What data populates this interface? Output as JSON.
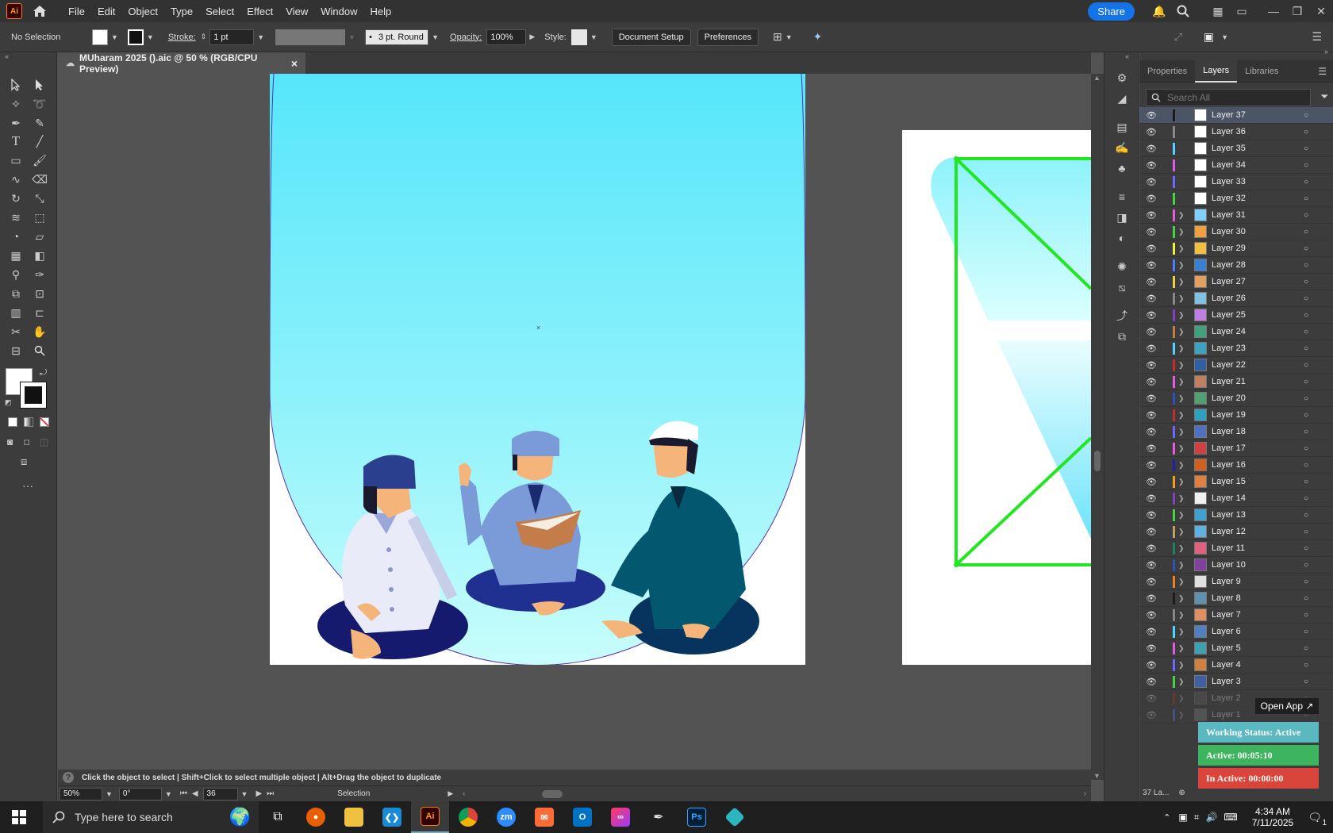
{
  "menubar": {
    "app_icon": "Ai",
    "items": [
      "File",
      "Edit",
      "Object",
      "Type",
      "Select",
      "Effect",
      "View",
      "Window",
      "Help"
    ],
    "share_label": "Share"
  },
  "control_bar": {
    "selection": "No Selection",
    "stroke_label": "Stroke:",
    "stroke_value": "1 pt",
    "brush": "3 pt. Round",
    "opacity_label": "Opacity:",
    "opacity_value": "100%",
    "style_label": "Style:",
    "document_setup": "Document Setup",
    "preferences": "Preferences"
  },
  "document_tab": {
    "title": "MUharam 2025 ().aic @ 50 % (RGB/CPU Preview)",
    "close": "×"
  },
  "status": {
    "hint": "Click the object to select  |  Shift+Click to select multiple object  |  Alt+Drag the object to duplicate",
    "zoom": "50%",
    "rotation": "0°",
    "artboard": "36",
    "tool": "Selection"
  },
  "panel": {
    "tabs": [
      "Properties",
      "Layers",
      "Libraries"
    ],
    "active_tab": "Layers",
    "search_placeholder": "Search All",
    "footer_count": "37 La...",
    "layers": [
      {
        "name": "Layer 37",
        "color": "#1a1a1a",
        "thumb": "#ffffff",
        "expand": false
      },
      {
        "name": "Layer 36",
        "color": "#888888",
        "thumb": "#ffffff",
        "expand": false
      },
      {
        "name": "Layer 35",
        "color": "#4fd6ff",
        "thumb": "#ffffff",
        "expand": false
      },
      {
        "name": "Layer 34",
        "color": "#e05ce0",
        "thumb": "#ffffff",
        "expand": false
      },
      {
        "name": "Layer 33",
        "color": "#6a6aff",
        "thumb": "#ffffff",
        "expand": false
      },
      {
        "name": "Layer 32",
        "color": "#46d446",
        "thumb": "#ffffff",
        "expand": false
      },
      {
        "name": "Layer 31",
        "color": "#e05ce0",
        "thumb": "#7fd0ff",
        "expand": true
      },
      {
        "name": "Layer 30",
        "color": "#46d446",
        "thumb": "#f0a040",
        "expand": true
      },
      {
        "name": "Layer 29",
        "color": "#f0f040",
        "thumb": "#f0c040",
        "expand": true
      },
      {
        "name": "Layer 28",
        "color": "#4f7fff",
        "thumb": "#3a80d0",
        "expand": true
      },
      {
        "name": "Layer 27",
        "color": "#f0d040",
        "thumb": "#e0a060",
        "expand": true
      },
      {
        "name": "Layer 26",
        "color": "#888888",
        "thumb": "#80c0e0",
        "expand": true
      },
      {
        "name": "Layer 25",
        "color": "#8040c0",
        "thumb": "#c080e0",
        "expand": true
      },
      {
        "name": "Layer 24",
        "color": "#c08040",
        "thumb": "#40a080",
        "expand": true
      },
      {
        "name": "Layer 23",
        "color": "#4fd6ff",
        "thumb": "#40a0c0",
        "expand": true
      },
      {
        "name": "Layer 22",
        "color": "#c03030",
        "thumb": "#3060a0",
        "expand": true
      },
      {
        "name": "Layer 21",
        "color": "#e05ce0",
        "thumb": "#c08060",
        "expand": true
      },
      {
        "name": "Layer 20",
        "color": "#3050c0",
        "thumb": "#50a070",
        "expand": true
      },
      {
        "name": "Layer 19",
        "color": "#c03030",
        "thumb": "#30a0c0",
        "expand": true
      },
      {
        "name": "Layer 18",
        "color": "#6a6aff",
        "thumb": "#5070c0",
        "expand": true
      },
      {
        "name": "Layer 17",
        "color": "#e05ce0",
        "thumb": "#d04040",
        "expand": true
      },
      {
        "name": "Layer 16",
        "color": "#2020a0",
        "thumb": "#d06020",
        "expand": true
      },
      {
        "name": "Layer 15",
        "color": "#f0a020",
        "thumb": "#e08040",
        "expand": true
      },
      {
        "name": "Layer 14",
        "color": "#8040c0",
        "thumb": "#f0f0f0",
        "expand": true
      },
      {
        "name": "Layer 13",
        "color": "#46d446",
        "thumb": "#40a0d0",
        "expand": true
      },
      {
        "name": "Layer 12",
        "color": "#c0a060",
        "thumb": "#60b0e0",
        "expand": true
      },
      {
        "name": "Layer 11",
        "color": "#208060",
        "thumb": "#e06080",
        "expand": true
      },
      {
        "name": "Layer 10",
        "color": "#3050c0",
        "thumb": "#8040a0",
        "expand": true
      },
      {
        "name": "Layer 9",
        "color": "#f08020",
        "thumb": "#e0e0e0",
        "expand": true
      },
      {
        "name": "Layer 8",
        "color": "#1a1a1a",
        "thumb": "#6090b0",
        "expand": true
      },
      {
        "name": "Layer 7",
        "color": "#888888",
        "thumb": "#e09060",
        "expand": true
      },
      {
        "name": "Layer 6",
        "color": "#4fd6ff",
        "thumb": "#5080c0",
        "expand": true
      },
      {
        "name": "Layer 5",
        "color": "#e05ce0",
        "thumb": "#40a0b0",
        "expand": true
      },
      {
        "name": "Layer 4",
        "color": "#6a6aff",
        "thumb": "#d08040",
        "expand": true
      },
      {
        "name": "Layer 3",
        "color": "#46d446",
        "thumb": "#4060a0",
        "expand": true
      },
      {
        "name": "Layer 2",
        "color": "#c03030",
        "thumb": "#606060",
        "expand": true
      },
      {
        "name": "Layer 1",
        "color": "#4f7fff",
        "thumb": "#808080",
        "expand": true
      }
    ]
  },
  "plugin": {
    "open_app": "Open App ↗",
    "working_status": "Working Status: Active",
    "active": "Active: 00:05:10",
    "inactive": "In Active: 00:00:00"
  },
  "taskbar": {
    "search_placeholder": "Type here to search",
    "time": "4:34 AM",
    "date": "7/11/2025",
    "notification_count": "1"
  },
  "colors": {
    "accent": "#1473e6",
    "selection_green": "#22e622",
    "sky_top": "#56e6fb",
    "sky_bottom": "#c8fdfb",
    "status_active": "#3db55e",
    "status_inactive": "#d9453a",
    "status_working": "#5ab9c0"
  }
}
